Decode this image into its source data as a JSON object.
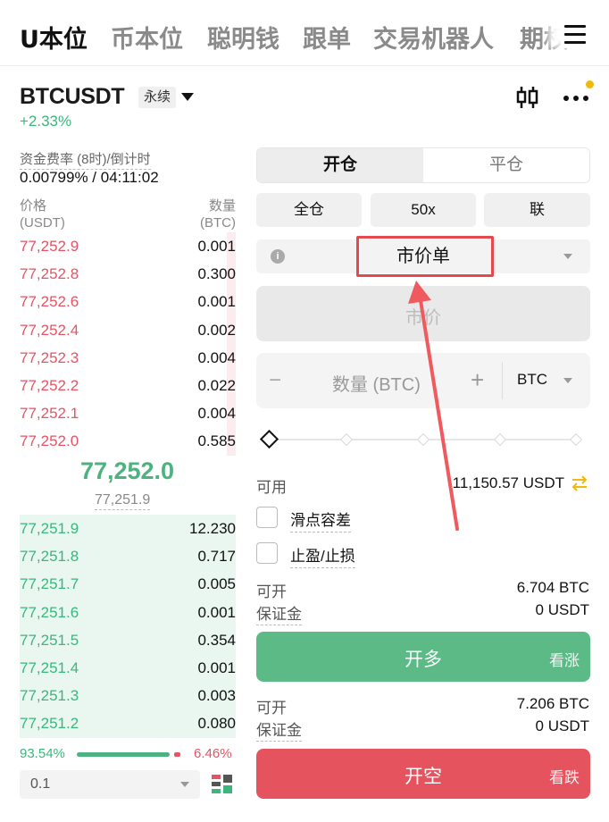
{
  "nav": {
    "tabs": [
      "U本位",
      "币本位",
      "聪明钱",
      "跟单",
      "交易机器人",
      "期权"
    ],
    "active_index": 0
  },
  "symbol": {
    "name": "BTCUSDT",
    "badge": "永续",
    "change": "+2.33%"
  },
  "funding": {
    "label": "资金费率 (8时)/倒计时",
    "value": "0.00799% / 04:11:02"
  },
  "orderbook": {
    "price_header": "价格",
    "price_unit": "(USDT)",
    "qty_header": "数量",
    "qty_unit": "(BTC)",
    "asks": [
      {
        "price": "77,252.9",
        "qty": "0.001",
        "depth": 0.04
      },
      {
        "price": "77,252.8",
        "qty": "0.300",
        "depth": 0.04
      },
      {
        "price": "77,252.6",
        "qty": "0.001",
        "depth": 0.04
      },
      {
        "price": "77,252.4",
        "qty": "0.002",
        "depth": 0.04
      },
      {
        "price": "77,252.3",
        "qty": "0.004",
        "depth": 0.04
      },
      {
        "price": "77,252.2",
        "qty": "0.022",
        "depth": 0.04
      },
      {
        "price": "77,252.1",
        "qty": "0.004",
        "depth": 0.04
      },
      {
        "price": "77,252.0",
        "qty": "0.585",
        "depth": 0.04
      }
    ],
    "last_price": "77,252.0",
    "mark_price": "77,251.9",
    "bids": [
      {
        "price": "77,251.9",
        "qty": "12.230",
        "depth": 1.0
      },
      {
        "price": "77,251.8",
        "qty": "0.717",
        "depth": 1.0
      },
      {
        "price": "77,251.7",
        "qty": "0.005",
        "depth": 1.0
      },
      {
        "price": "77,251.6",
        "qty": "0.001",
        "depth": 1.0
      },
      {
        "price": "77,251.5",
        "qty": "0.354",
        "depth": 1.0
      },
      {
        "price": "77,251.4",
        "qty": "0.001",
        "depth": 1.0
      },
      {
        "price": "77,251.3",
        "qty": "0.003",
        "depth": 1.0
      },
      {
        "price": "77,251.2",
        "qty": "0.080",
        "depth": 1.0
      }
    ],
    "buy_ratio": "93.54%",
    "sell_ratio": "6.46%",
    "depth_step": "0.1"
  },
  "trade": {
    "open_tab": "开仓",
    "close_tab": "平仓",
    "margin_mode": "全仓",
    "leverage": "50x",
    "position_mode": "联",
    "order_type": "市价单",
    "price_placeholder": "市价",
    "qty_placeholder": "数量 (BTC)",
    "qty_minus": "−",
    "qty_plus": "+",
    "qty_unit": "BTC",
    "slider_percent": 0,
    "available_label": "可用",
    "available_value": "11,150.57 USDT",
    "slippage_label": "滑点容差",
    "tpsl_label": "止盈/止损",
    "long": {
      "can_open_label": "可开",
      "can_open_value": "6.704 BTC",
      "margin_label": "保证金",
      "margin_value": "0 USDT",
      "button": "开多",
      "side": "看涨"
    },
    "short": {
      "can_open_label": "可开",
      "can_open_value": "7.206 BTC",
      "margin_label": "保证金",
      "margin_value": "0 USDT",
      "button": "开空",
      "side": "看跌"
    }
  },
  "colors": {
    "up": "#3ab77c",
    "down": "#e45464",
    "long_button": "#5cba87",
    "short_button": "#e5535f",
    "annotation": "#e5484d",
    "accent": "#f0b90b"
  },
  "icons": [
    "menu-icon",
    "chevron-down-icon",
    "candlestick-icon",
    "more-icon",
    "info-icon",
    "swap-icon",
    "layout-icon",
    "annotation-arrow"
  ]
}
